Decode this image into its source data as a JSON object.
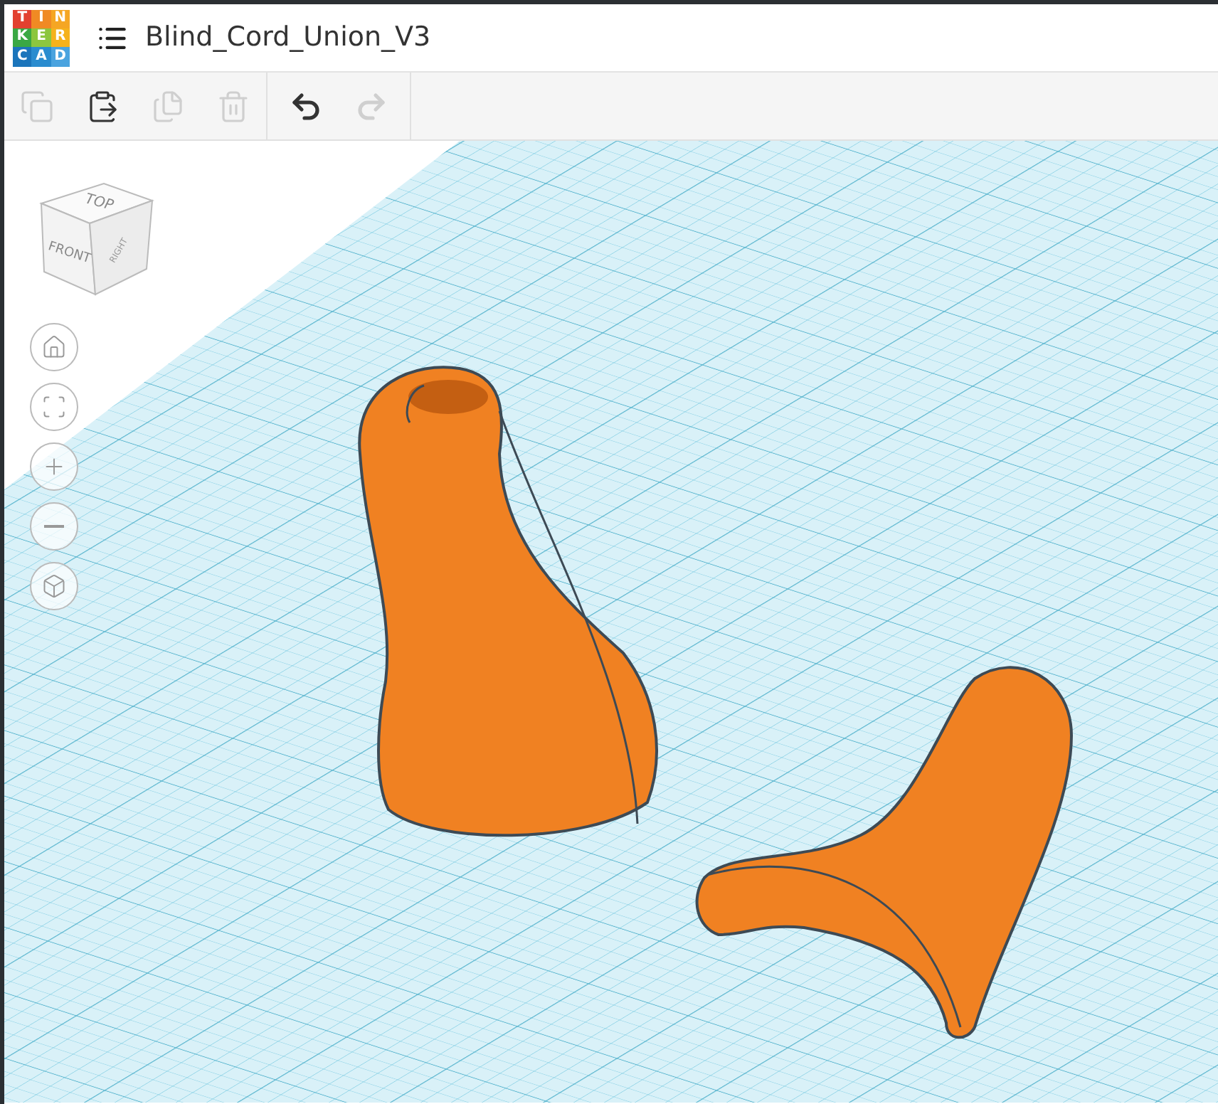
{
  "header": {
    "logo_letters": [
      {
        "letter": "T",
        "color": "#e2402f"
      },
      {
        "letter": "I",
        "color": "#f08a24"
      },
      {
        "letter": "N",
        "color": "#f5a623"
      },
      {
        "letter": "K",
        "color": "#3aa844"
      },
      {
        "letter": "E",
        "color": "#8cc63f"
      },
      {
        "letter": "R",
        "color": "#f5b21c"
      },
      {
        "letter": "C",
        "color": "#1b75bb"
      },
      {
        "letter": "A",
        "color": "#2a8ccf"
      },
      {
        "letter": "D",
        "color": "#4aa3df"
      }
    ],
    "title": "Blind_Cord_Union_V3"
  },
  "toolbar": [
    {
      "kind": "copy",
      "disabled": true
    },
    {
      "kind": "paste",
      "disabled": false
    },
    {
      "kind": "duplicate",
      "disabled": true
    },
    {
      "kind": "delete",
      "disabled": true
    },
    {
      "kind": "undo",
      "disabled": false
    },
    {
      "kind": "redo",
      "disabled": true
    }
  ],
  "view_cube": {
    "faces": [
      "TOP",
      "FRONT",
      "RIGHT"
    ]
  },
  "view_controls": [
    {
      "kind": "home"
    },
    {
      "kind": "fit"
    },
    {
      "kind": "zoom_in"
    },
    {
      "kind": "zoom_out"
    },
    {
      "kind": "projection"
    }
  ]
}
